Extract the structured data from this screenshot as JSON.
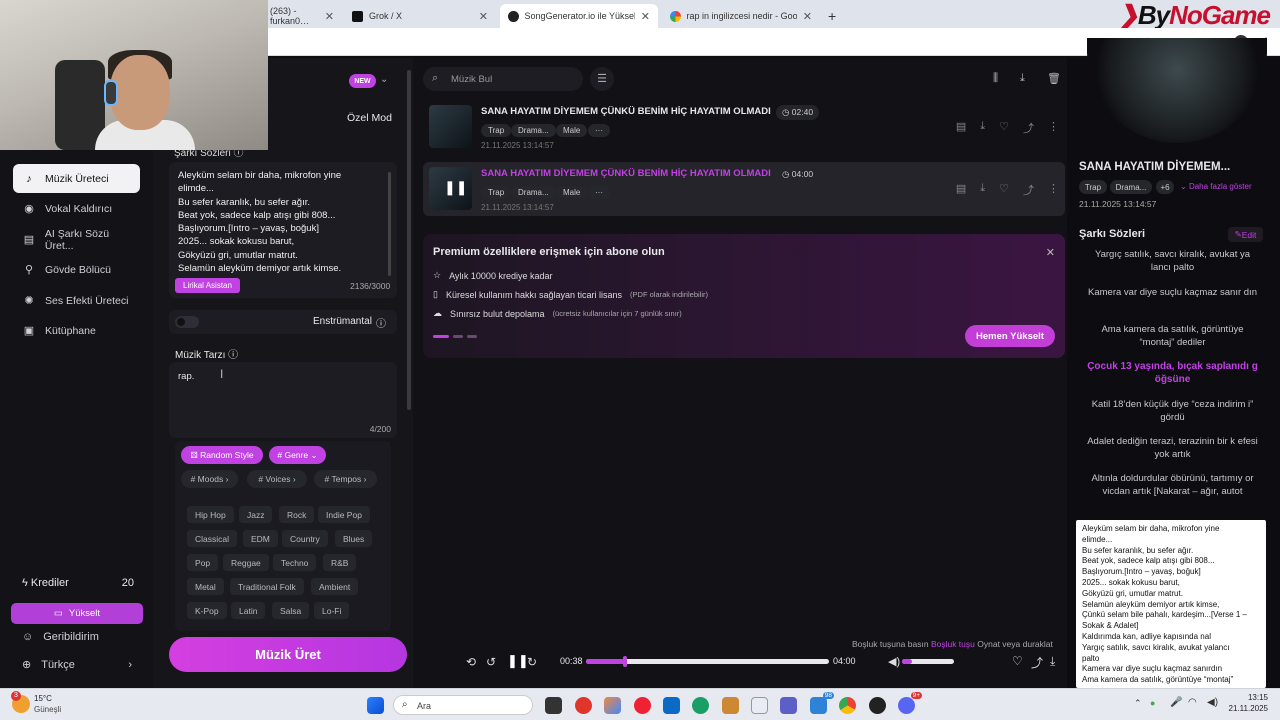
{
  "browser": {
    "tabs": [
      {
        "label": "(263) - furkan0…"
      },
      {
        "label": "Grok / X"
      },
      {
        "label": "SongGenerator.io ile Yüksek Ka…"
      },
      {
        "label": "rap in ingilizcesi nedir - Google"
      }
    ],
    "new_tab": "+",
    "brand_a": "By",
    "brand_b": "NoGame"
  },
  "sidebar": {
    "items": [
      {
        "label": "Müzik Üreteci",
        "icon": "music-note-icon"
      },
      {
        "label": "Vokal Kaldırıcı",
        "icon": "vocal-icon"
      },
      {
        "label": "AI Şarkı Sözü Üret...",
        "icon": "lyrics-icon"
      },
      {
        "label": "Gövde Bölücü",
        "icon": "split-icon"
      },
      {
        "label": "Ses Efekti Üreteci",
        "icon": "sound-effect-icon"
      },
      {
        "label": "Kütüphane",
        "icon": "library-icon"
      }
    ],
    "credits_label": "Krediler",
    "credits_value": "20",
    "upgrade": "Yükselt",
    "feedback": "Geribildirim",
    "language": "Türkçe"
  },
  "form": {
    "new_badge": "NEW",
    "custom_mode": "Özel Mod",
    "lyrics_label": "Şarkı Sözleri",
    "lyrics_lines": [
      "Aleyküm selam bir daha, mikrofon yine",
      "elimde...",
      "Bu sefer karanlık, bu sefer ağır.",
      "Beat yok, sadece kalp atışı gibi 808...",
      "Başlıyorum.[Intro – yavaş, boğuk]",
      "2025... sokak kokusu barut,",
      "Gökyüzü gri, umutlar matrut.",
      "Selamün aleyküm demiyor artık kimse."
    ],
    "lyric_assistant": "Lirikal Asistan",
    "lyrics_count": "2136/3000",
    "instrumental": "Enstrümantal",
    "style_label": "Müzik Tarzı",
    "style_value": "rap.",
    "style_count": "4/200",
    "random_style": "Random Style",
    "genre": "# Genre",
    "moods": "# Moods",
    "voices": "# Voices",
    "tempos": "# Tempos",
    "genres": [
      "Hip Hop",
      "Jazz",
      "Rock",
      "Indie Pop",
      "Classical",
      "EDM",
      "Country",
      "Blues",
      "Pop",
      "Reggae",
      "Techno",
      "R&B",
      "Metal",
      "Traditional Folk",
      "Ambient",
      "K-Pop",
      "Latin",
      "Salsa",
      "Lo-Fi"
    ],
    "generate": "Müzik Üret"
  },
  "main": {
    "search_placeholder": "Müzik Bul",
    "songs": [
      {
        "title": "SANA HAYATIM DİYEMEM ÇÜNKÜ BENİM HİÇ HAYATIM OLMADI",
        "duration": "02:40",
        "tags": [
          "Trap",
          "Drama...",
          "Male",
          "···"
        ],
        "date": "21.11.2025 13:14:57"
      },
      {
        "title": "SANA HAYATIM DİYEMEM ÇÜNKÜ BENİM HİÇ HAYATIM OLMADI",
        "duration": "04:00",
        "tags": [
          "Trap",
          "Drama...",
          "Male",
          "···"
        ],
        "date": "21.11.2025 13:14:57"
      }
    ],
    "promo": {
      "title": "Premium özelliklere erişmek için abone olun",
      "lines": [
        {
          "text": "Aylık 10000 krediye kadar",
          "note": ""
        },
        {
          "text": "Küresel kullanım hakkı sağlayan ticari lisans",
          "note": "(PDF olarak indirilebilir)"
        },
        {
          "text": "Sınırsız bulut depolama",
          "note": "(ücretsiz kullanıcılar için 7 günlük sınır)"
        }
      ],
      "button": "Hemen Yükselt"
    },
    "hint_a": "Boşluk tuşuna basın",
    "hint_key": "Boşluk tuşu",
    "hint_b": "Oynat veya duraklat",
    "player": {
      "elapsed": "00:38",
      "total": "04:00",
      "progress": 0.16,
      "volume": 0.2
    }
  },
  "right": {
    "title": "SANA HAYATIM DİYEMEM...",
    "tags": [
      "Trap",
      "Drama...",
      "+6"
    ],
    "more": "Daha fazla göster",
    "date": "21.11.2025 13:14:57",
    "lyrics_heading": "Şarkı Sözleri",
    "edit": "Edit",
    "lyric_lines": [
      "Yargıç satılık, savcı kiralık, avukat ya lancı palto",
      "Kamera var diye suçlu kaçmaz sanır dın",
      "Ama kamera da satılık, görüntüye “montaj” dediler",
      "Çocuk 13 yaşında, bıçak saplanıdı g öğsüne",
      "Katil 18’den küçük diye “ceza indirim i” gördü",
      "Adalet dediğin terazi, terazinin bir k efesi yok artık",
      "Altınla doldurdular öbürünü, tartımıy or vicdan artık [Nakarat – ağır, autot"
    ],
    "box_lines": [
      "Aleyküm selam bir daha, mikrofon yine",
      "elimde...",
      "Bu sefer karanlık, bu sefer ağır.",
      "Beat yok, sadece kalp atışı gibi 808...",
      "Başlıyorum.[Intro – yavaş, boğuk]",
      "2025... sokak kokusu barut,",
      "Gökyüzü gri, umutlar matrut.",
      "Selamün aleyküm demiyor artık kimse,",
      "Çünkü selam bile pahalı, kardeşim...[Verse 1 –",
      "Sokak & Adalet]",
      "Kaldırımda kan, adliye kapısında nal",
      "Yargıç satılık, savcı kiralık, avukat yalancı",
      "palto",
      "Kamera var diye suçlu kaçmaz sanırdın",
      "Ama kamera da satılık, görüntüye “montaj”"
    ]
  },
  "taskbar": {
    "weather_temp": "15°C",
    "weather_desc": "Güneşli",
    "weather_badge": "3",
    "search": "Ara",
    "badge_teams": "98",
    "badge_discord": "9+",
    "time": "13:15",
    "date": "21.11.2025"
  },
  "colors": {
    "accent": "#c042e3",
    "brand_red": "#c8102e"
  }
}
